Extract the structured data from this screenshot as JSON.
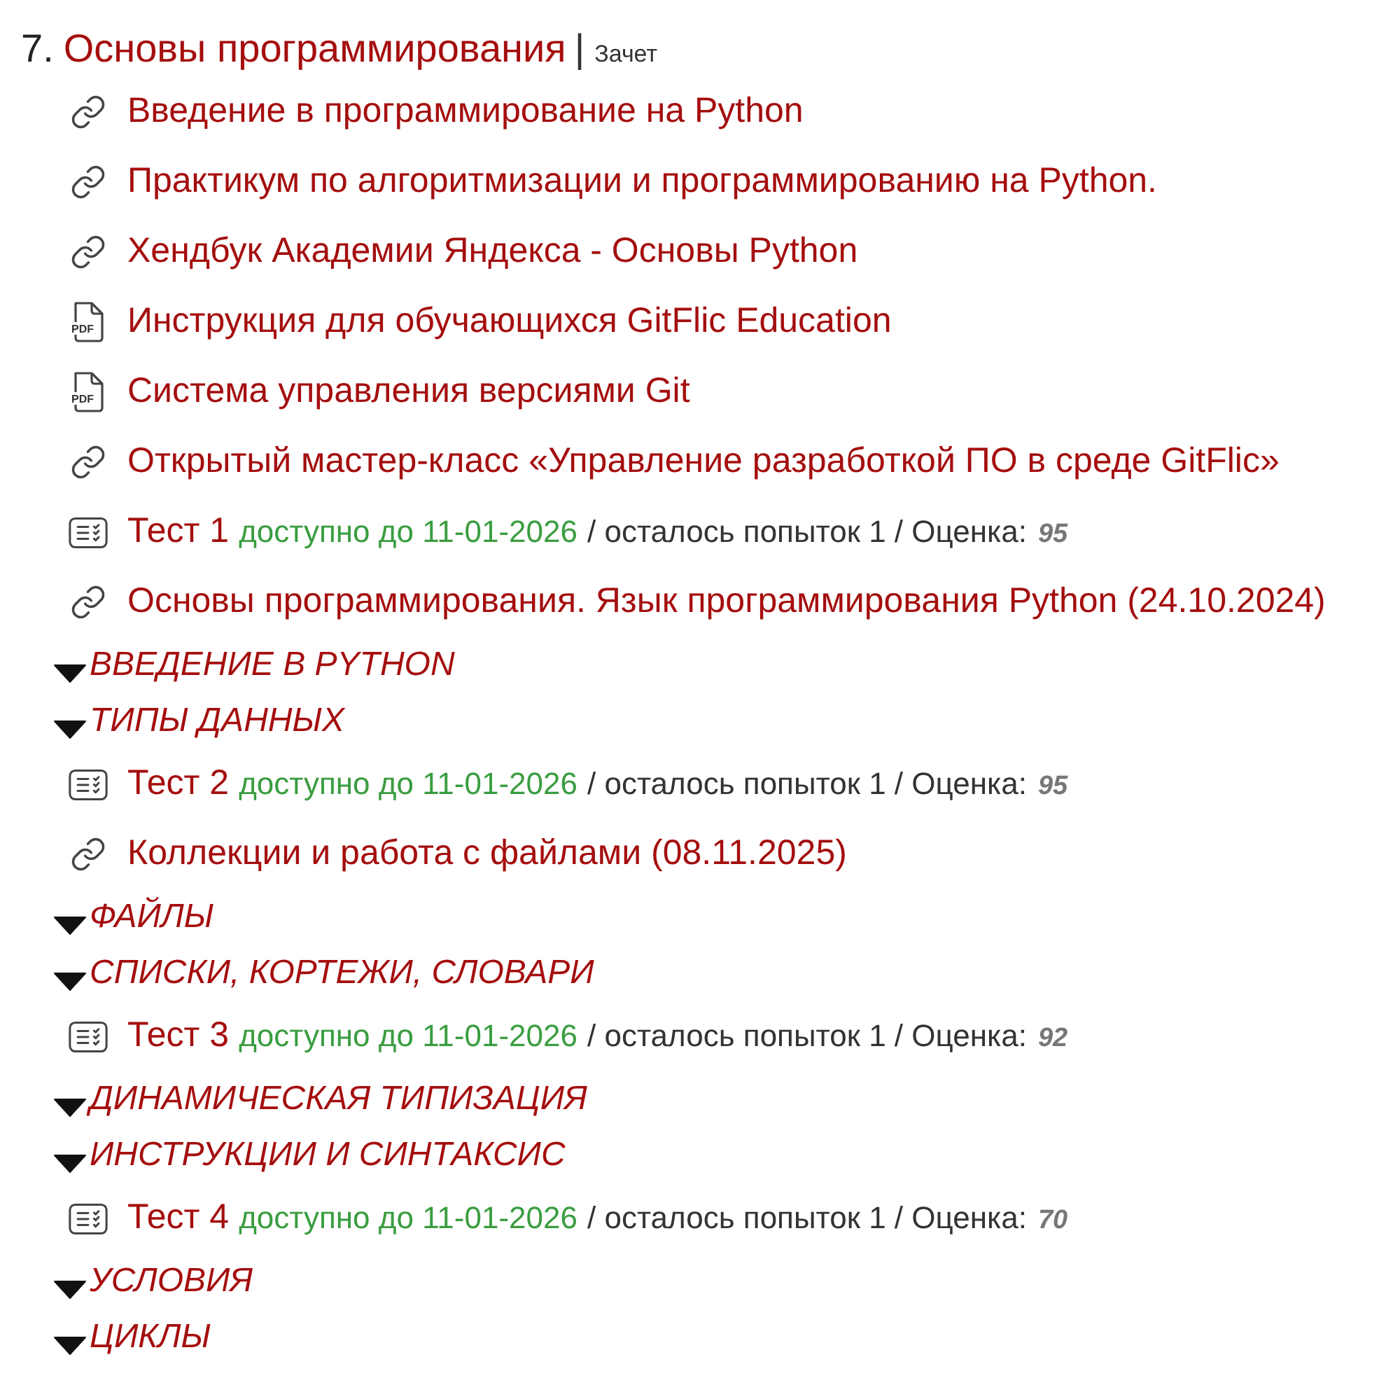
{
  "course": {
    "number": "7.",
    "title": "Основы программирования",
    "separator": "|",
    "assessment": "Зачет"
  },
  "items": [
    {
      "kind": "link",
      "title": "Введение в программирование на Python"
    },
    {
      "kind": "link",
      "title": "Практикум по алгоритмизации и программированию на Python."
    },
    {
      "kind": "link",
      "title": "Хендбук Академии Яндекса - Основы Python"
    },
    {
      "kind": "pdf",
      "icon_text": "PDF",
      "title": "Инструкция для обучающихся GitFlic Education"
    },
    {
      "kind": "pdf",
      "icon_text": "PDF",
      "title": "Система управления версиями Git"
    },
    {
      "kind": "link",
      "title": "Открытый мастер-класс «Управление разработкой ПО в среде GitFlic»"
    },
    {
      "kind": "test",
      "title": "Тест 1",
      "availability": "доступно до 11-01-2026",
      "details": "/ осталось попыток 1 / Оценка:",
      "score": "95"
    },
    {
      "kind": "link",
      "title": "Основы программирования. Язык программирования Python (24.10.2024)"
    },
    {
      "kind": "section",
      "title": "ВВЕДЕНИЕ В PYTHON",
      "expanded": true
    },
    {
      "kind": "section",
      "title": "ТИПЫ ДАННЫХ",
      "expanded": true
    },
    {
      "kind": "test",
      "title": "Тест 2",
      "availability": "доступно до 11-01-2026",
      "details": "/ осталось попыток 1 / Оценка:",
      "score": "95"
    },
    {
      "kind": "link",
      "title": "Коллекции и работа с файлами (08.11.2025)"
    },
    {
      "kind": "section",
      "title": "ФАЙЛЫ",
      "expanded": true
    },
    {
      "kind": "section",
      "title": "СПИСКИ, КОРТЕЖИ, СЛОВАРИ",
      "expanded": true
    },
    {
      "kind": "test",
      "title": "Тест 3",
      "availability": "доступно до 11-01-2026",
      "details": "/ осталось попыток 1 / Оценка:",
      "score": "92"
    },
    {
      "kind": "section",
      "title": "ДИНАМИЧЕСКАЯ ТИПИЗАЦИЯ",
      "expanded": true
    },
    {
      "kind": "section",
      "title": "ИНСТРУКЦИИ И СИНТАКСИС",
      "expanded": true
    },
    {
      "kind": "test",
      "title": "Тест 4",
      "availability": "доступно до 11-01-2026",
      "details": "/ осталось попыток 1 / Оценка:",
      "score": "70"
    },
    {
      "kind": "section",
      "title": "УСЛОВИЯ",
      "expanded": true
    },
    {
      "kind": "section",
      "title": "ЦИКЛЫ",
      "expanded": true
    }
  ]
}
